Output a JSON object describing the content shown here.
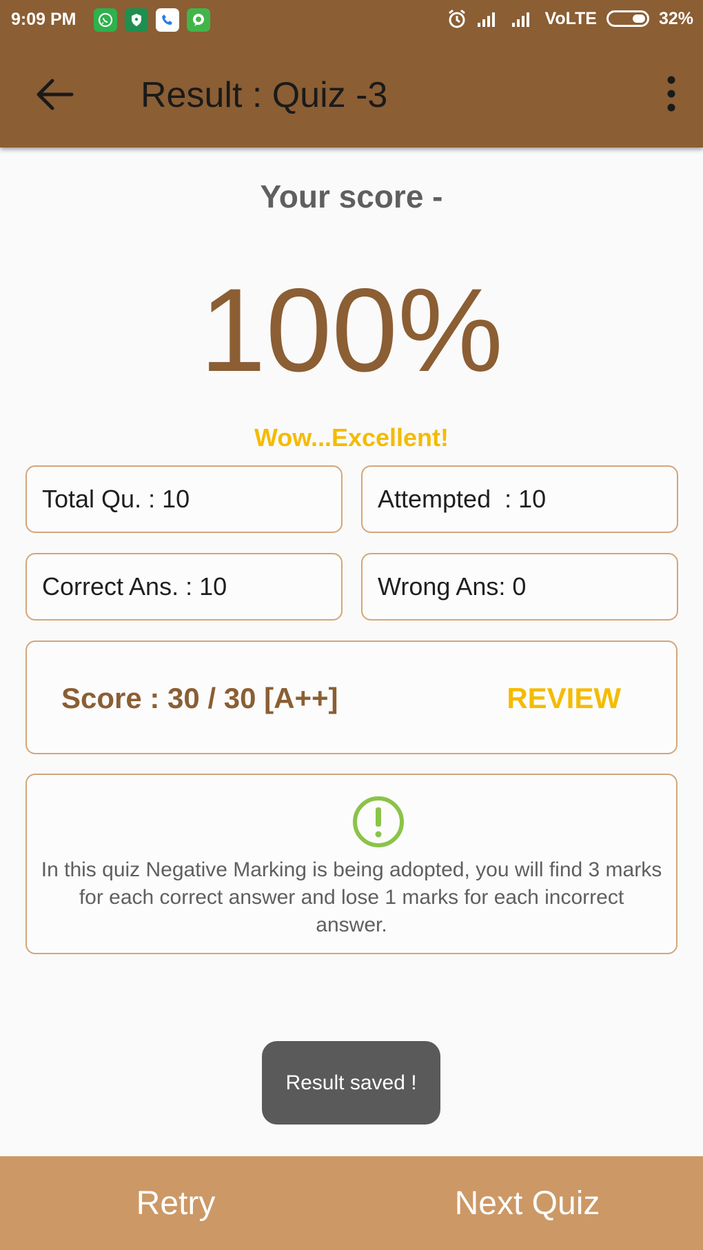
{
  "status_bar": {
    "time": "9:09 PM",
    "network": "VoLTE",
    "battery": "32%",
    "notification_icons": [
      "whatsapp-icon",
      "shield-icon",
      "phone-icon",
      "chat-icon"
    ]
  },
  "app_bar": {
    "title": "Result : Quiz -3",
    "back_icon": "back-arrow-icon",
    "menu_icon": "more-vert-icon"
  },
  "result": {
    "heading": "Your score -",
    "percent": "100%",
    "remark": "Wow...Excellent!"
  },
  "stats": {
    "total": "Total Qu. : 10",
    "attempted": "Attempted  : 10",
    "correct": "Correct Ans. : 10",
    "wrong": "Wrong Ans: 0"
  },
  "score": {
    "label": "Score : 30 / 30 [A++]",
    "review_label": "REVIEW"
  },
  "note": {
    "icon": "warning-circle-icon",
    "text": "In this quiz Negative Marking is being adopted, you will find 3 marks for each correct answer and lose 1 marks for each incorrect answer."
  },
  "toast": "Result saved !",
  "bottom_bar": {
    "retry_label": "Retry",
    "next_label": "Next Quiz"
  },
  "colors": {
    "primary": "#8b5e34",
    "accent": "#f5bb00",
    "bottom_bar": "#cc9866",
    "box_border": "#d2a679",
    "warning_icon": "#8bc34a"
  }
}
